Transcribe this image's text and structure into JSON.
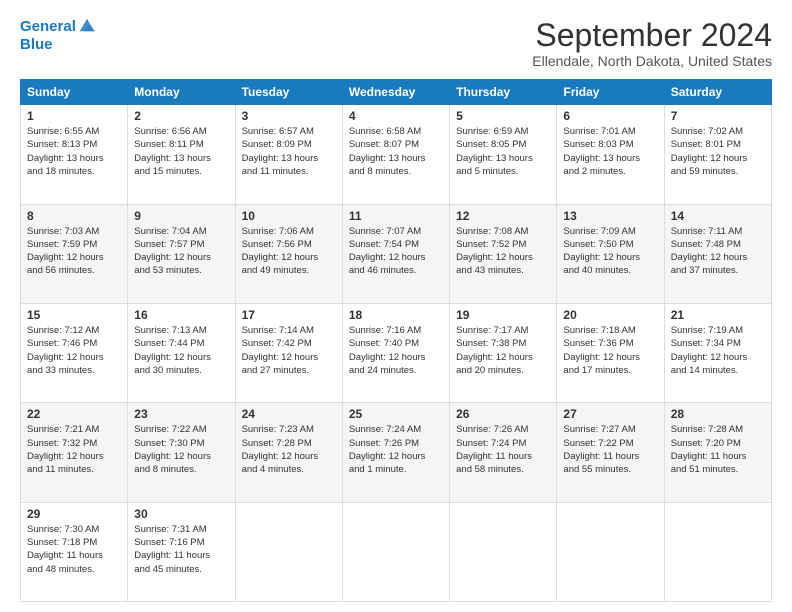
{
  "header": {
    "logo_line1": "General",
    "logo_line2": "Blue",
    "month": "September 2024",
    "location": "Ellendale, North Dakota, United States"
  },
  "days_of_week": [
    "Sunday",
    "Monday",
    "Tuesday",
    "Wednesday",
    "Thursday",
    "Friday",
    "Saturday"
  ],
  "weeks": [
    [
      {
        "day": "1",
        "info": "Sunrise: 6:55 AM\nSunset: 8:13 PM\nDaylight: 13 hours\nand 18 minutes."
      },
      {
        "day": "2",
        "info": "Sunrise: 6:56 AM\nSunset: 8:11 PM\nDaylight: 13 hours\nand 15 minutes."
      },
      {
        "day": "3",
        "info": "Sunrise: 6:57 AM\nSunset: 8:09 PM\nDaylight: 13 hours\nand 11 minutes."
      },
      {
        "day": "4",
        "info": "Sunrise: 6:58 AM\nSunset: 8:07 PM\nDaylight: 13 hours\nand 8 minutes."
      },
      {
        "day": "5",
        "info": "Sunrise: 6:59 AM\nSunset: 8:05 PM\nDaylight: 13 hours\nand 5 minutes."
      },
      {
        "day": "6",
        "info": "Sunrise: 7:01 AM\nSunset: 8:03 PM\nDaylight: 13 hours\nand 2 minutes."
      },
      {
        "day": "7",
        "info": "Sunrise: 7:02 AM\nSunset: 8:01 PM\nDaylight: 12 hours\nand 59 minutes."
      }
    ],
    [
      {
        "day": "8",
        "info": "Sunrise: 7:03 AM\nSunset: 7:59 PM\nDaylight: 12 hours\nand 56 minutes."
      },
      {
        "day": "9",
        "info": "Sunrise: 7:04 AM\nSunset: 7:57 PM\nDaylight: 12 hours\nand 53 minutes."
      },
      {
        "day": "10",
        "info": "Sunrise: 7:06 AM\nSunset: 7:56 PM\nDaylight: 12 hours\nand 49 minutes."
      },
      {
        "day": "11",
        "info": "Sunrise: 7:07 AM\nSunset: 7:54 PM\nDaylight: 12 hours\nand 46 minutes."
      },
      {
        "day": "12",
        "info": "Sunrise: 7:08 AM\nSunset: 7:52 PM\nDaylight: 12 hours\nand 43 minutes."
      },
      {
        "day": "13",
        "info": "Sunrise: 7:09 AM\nSunset: 7:50 PM\nDaylight: 12 hours\nand 40 minutes."
      },
      {
        "day": "14",
        "info": "Sunrise: 7:11 AM\nSunset: 7:48 PM\nDaylight: 12 hours\nand 37 minutes."
      }
    ],
    [
      {
        "day": "15",
        "info": "Sunrise: 7:12 AM\nSunset: 7:46 PM\nDaylight: 12 hours\nand 33 minutes."
      },
      {
        "day": "16",
        "info": "Sunrise: 7:13 AM\nSunset: 7:44 PM\nDaylight: 12 hours\nand 30 minutes."
      },
      {
        "day": "17",
        "info": "Sunrise: 7:14 AM\nSunset: 7:42 PM\nDaylight: 12 hours\nand 27 minutes."
      },
      {
        "day": "18",
        "info": "Sunrise: 7:16 AM\nSunset: 7:40 PM\nDaylight: 12 hours\nand 24 minutes."
      },
      {
        "day": "19",
        "info": "Sunrise: 7:17 AM\nSunset: 7:38 PM\nDaylight: 12 hours\nand 20 minutes."
      },
      {
        "day": "20",
        "info": "Sunrise: 7:18 AM\nSunset: 7:36 PM\nDaylight: 12 hours\nand 17 minutes."
      },
      {
        "day": "21",
        "info": "Sunrise: 7:19 AM\nSunset: 7:34 PM\nDaylight: 12 hours\nand 14 minutes."
      }
    ],
    [
      {
        "day": "22",
        "info": "Sunrise: 7:21 AM\nSunset: 7:32 PM\nDaylight: 12 hours\nand 11 minutes."
      },
      {
        "day": "23",
        "info": "Sunrise: 7:22 AM\nSunset: 7:30 PM\nDaylight: 12 hours\nand 8 minutes."
      },
      {
        "day": "24",
        "info": "Sunrise: 7:23 AM\nSunset: 7:28 PM\nDaylight: 12 hours\nand 4 minutes."
      },
      {
        "day": "25",
        "info": "Sunrise: 7:24 AM\nSunset: 7:26 PM\nDaylight: 12 hours\nand 1 minute."
      },
      {
        "day": "26",
        "info": "Sunrise: 7:26 AM\nSunset: 7:24 PM\nDaylight: 11 hours\nand 58 minutes."
      },
      {
        "day": "27",
        "info": "Sunrise: 7:27 AM\nSunset: 7:22 PM\nDaylight: 11 hours\nand 55 minutes."
      },
      {
        "day": "28",
        "info": "Sunrise: 7:28 AM\nSunset: 7:20 PM\nDaylight: 11 hours\nand 51 minutes."
      }
    ],
    [
      {
        "day": "29",
        "info": "Sunrise: 7:30 AM\nSunset: 7:18 PM\nDaylight: 11 hours\nand 48 minutes."
      },
      {
        "day": "30",
        "info": "Sunrise: 7:31 AM\nSunset: 7:16 PM\nDaylight: 11 hours\nand 45 minutes."
      },
      {
        "day": "",
        "info": ""
      },
      {
        "day": "",
        "info": ""
      },
      {
        "day": "",
        "info": ""
      },
      {
        "day": "",
        "info": ""
      },
      {
        "day": "",
        "info": ""
      }
    ]
  ]
}
